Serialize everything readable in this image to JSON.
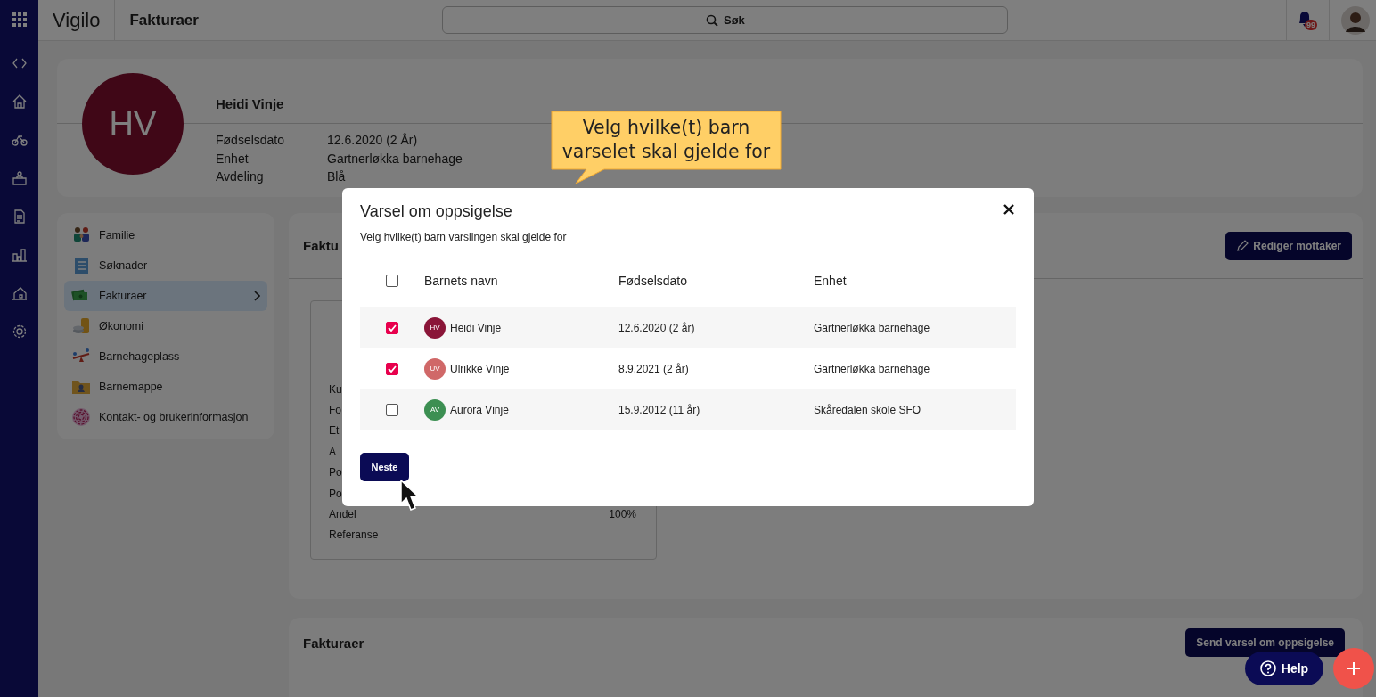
{
  "topbar": {
    "logo": "Vigilo",
    "page_title": "Fakturaer",
    "search": {
      "placeholder": "Søk"
    },
    "notification_count": "99"
  },
  "profile": {
    "initials": "HV",
    "name": "Heidi Vinje",
    "details": [
      {
        "label": "Fødselsdato",
        "value": "12.6.2020 (2 År)"
      },
      {
        "label": "Enhet",
        "value": "Gartnerløkka barnehage"
      },
      {
        "label": "Avdeling",
        "value": "Blå"
      }
    ]
  },
  "sidebar": {
    "items": [
      {
        "label": "Familie",
        "selected": false
      },
      {
        "label": "Søknader",
        "selected": false
      },
      {
        "label": "Fakturaer",
        "selected": true
      },
      {
        "label": "Økonomi",
        "selected": false
      },
      {
        "label": "Barnehageplass",
        "selected": false
      },
      {
        "label": "Barnemappe",
        "selected": false
      },
      {
        "label": "Kontakt- og brukerinformasjon",
        "selected": false
      }
    ]
  },
  "invoice_card": {
    "title": "Faktu",
    "edit_button": "Rediger mottaker",
    "fields": [
      {
        "label": "Ku"
      },
      {
        "label": "Fo"
      },
      {
        "label": "Et"
      },
      {
        "label": "A"
      },
      {
        "label": "Po"
      },
      {
        "label": "Po"
      },
      {
        "label": "Andel",
        "value": "100%"
      },
      {
        "label": "Referanse"
      }
    ]
  },
  "invoices_card": {
    "title": "Fakturaer",
    "send_button": "Send varsel om oppsigelse"
  },
  "help_button": "Help",
  "modal": {
    "title": "Varsel om oppsigelse",
    "subtitle": "Velg hvilke(t) barn varslingen skal gjelde for",
    "select_all": {
      "checked": false
    },
    "columns": [
      "Barnets navn",
      "Fødselsdato",
      "Enhet"
    ],
    "rows": [
      {
        "checked": true,
        "initials": "HV",
        "color": "#8a1538",
        "name": "Heidi Vinje",
        "birth_date": "12.6.2020 (2 år)",
        "unit": "Gartnerløkka barnehage"
      },
      {
        "checked": true,
        "initials": "UV",
        "color": "#d06868",
        "name": "Ulrikke Vinje",
        "birth_date": "8.9.2021 (2 år)",
        "unit": "Gartnerløkka barnehage"
      },
      {
        "checked": false,
        "initials": "AV",
        "color": "#3c8f52",
        "name": "Aurora Vinje",
        "birth_date": "15.9.2012 (11 år)",
        "unit": "Skåredalen skole SFO"
      }
    ],
    "next_button": "Neste"
  },
  "callout": {
    "text": "Velg hvilke(t) barn varselet skal gjelde for"
  }
}
